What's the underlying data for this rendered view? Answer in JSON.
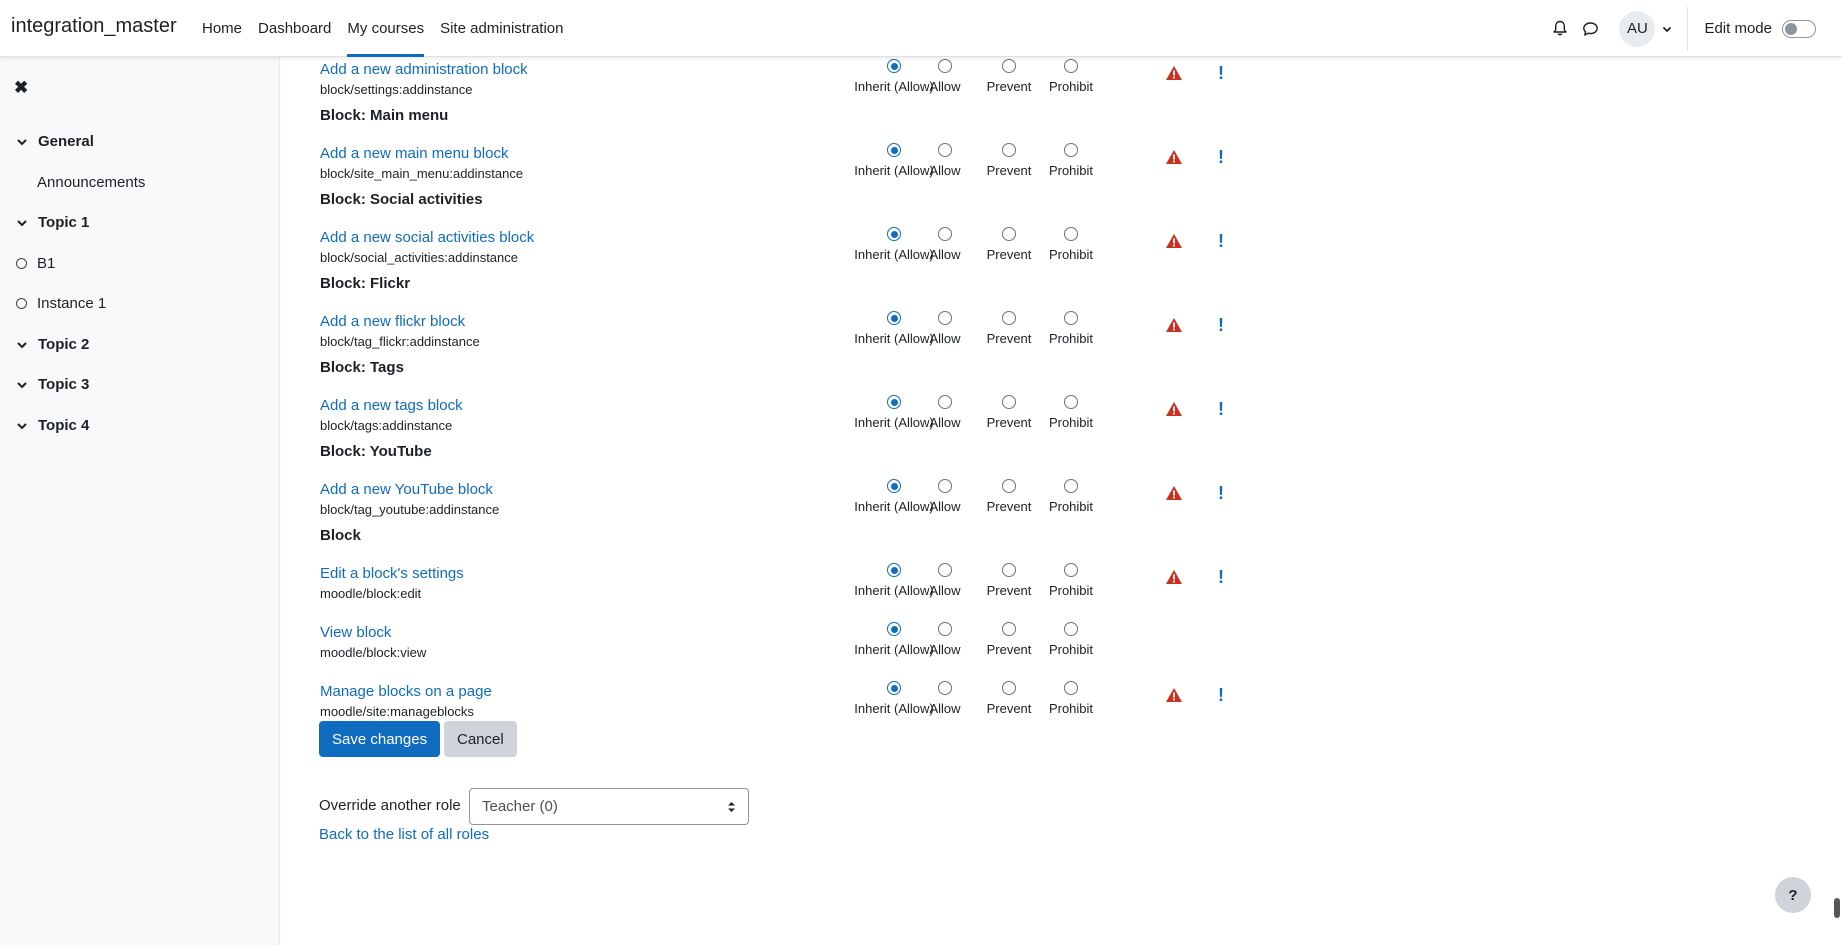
{
  "navbar": {
    "brand": "integration_master",
    "links": [
      {
        "label": "Home"
      },
      {
        "label": "Dashboard"
      },
      {
        "label": "My courses"
      },
      {
        "label": "Site administration"
      }
    ],
    "avatar_initials": "AU",
    "edit_mode_label": "Edit mode",
    "edit_mode_on": false
  },
  "drawer": {
    "items": [
      {
        "label": "General",
        "type": "section"
      },
      {
        "label": "Announcements",
        "type": "sub"
      },
      {
        "label": "Topic 1",
        "type": "section"
      },
      {
        "label": "B1",
        "type": "activity"
      },
      {
        "label": "Instance 1",
        "type": "activity"
      },
      {
        "label": "Topic 2",
        "type": "section"
      },
      {
        "label": "Topic 3",
        "type": "section"
      },
      {
        "label": "Topic 4",
        "type": "section"
      }
    ]
  },
  "permission_options": [
    "Inherit (Allow)",
    "Allow",
    "Prevent",
    "Prohibit"
  ],
  "groups": [
    {
      "heading": "",
      "caps": [
        {
          "label": "Add a new administration block",
          "name": "block/settings:addinstance",
          "selected": 0,
          "risks": true
        }
      ]
    },
    {
      "heading": "Block: Main menu",
      "caps": [
        {
          "label": "Add a new main menu block",
          "name": "block/site_main_menu:addinstance",
          "selected": 0,
          "risks": true
        }
      ]
    },
    {
      "heading": "Block: Social activities",
      "caps": [
        {
          "label": "Add a new social activities block",
          "name": "block/social_activities:addinstance",
          "selected": 0,
          "risks": true
        }
      ]
    },
    {
      "heading": "Block: Flickr",
      "caps": [
        {
          "label": "Add a new flickr block",
          "name": "block/tag_flickr:addinstance",
          "selected": 0,
          "risks": true
        }
      ]
    },
    {
      "heading": "Block: Tags",
      "caps": [
        {
          "label": "Add a new tags block",
          "name": "block/tags:addinstance",
          "selected": 0,
          "risks": true
        }
      ]
    },
    {
      "heading": "Block: YouTube",
      "caps": [
        {
          "label": "Add a new YouTube block",
          "name": "block/tag_youtube:addinstance",
          "selected": 0,
          "risks": true
        }
      ]
    },
    {
      "heading": "Block",
      "caps": [
        {
          "label": "Edit a block's settings",
          "name": "moodle/block:edit",
          "selected": 0,
          "risks": true
        },
        {
          "label": "View block",
          "name": "moodle/block:view",
          "selected": 0,
          "risks": false
        },
        {
          "label": "Manage blocks on a page",
          "name": "moodle/site:manageblocks",
          "selected": 0,
          "risks": true
        }
      ]
    }
  ],
  "buttons": {
    "save": "Save changes",
    "cancel": "Cancel"
  },
  "override": {
    "label": "Override another role",
    "selected": "Teacher (0)"
  },
  "back_link": "Back to the list of all roles",
  "help_label": "?"
}
